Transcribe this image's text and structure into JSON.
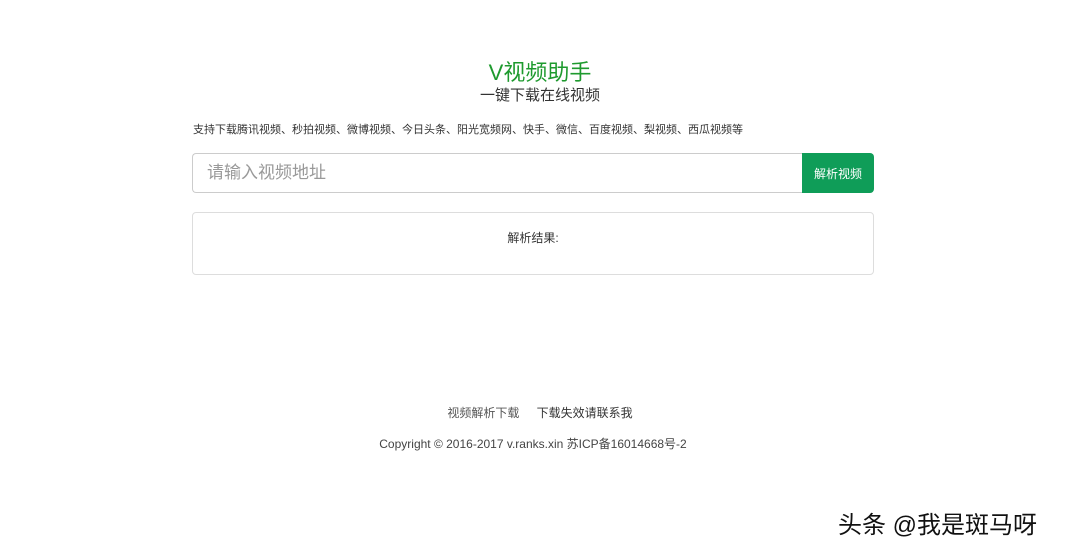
{
  "header": {
    "title": "V视频助手",
    "subtitle": "一键下载在线视频"
  },
  "support_text": "支持下载腾讯视频、秒拍视频、微博视频、今日头条、阳光宽频网、快手、微信、百度视频、梨视频、西瓜视频等",
  "search": {
    "placeholder": "请输入视频地址",
    "value": "",
    "button_label": "解析视频"
  },
  "result": {
    "label": "解析结果:"
  },
  "footer": {
    "links": [
      "视频解析下载",
      "下载失效请联系我"
    ],
    "copyright": "Copyright © 2016-2017 v.ranks.xin 苏ICP备16014668号-2"
  },
  "watermark": "头条 @我是斑马呀",
  "colors": {
    "accent": "#0f9d58",
    "title": "#1e9a2e"
  }
}
